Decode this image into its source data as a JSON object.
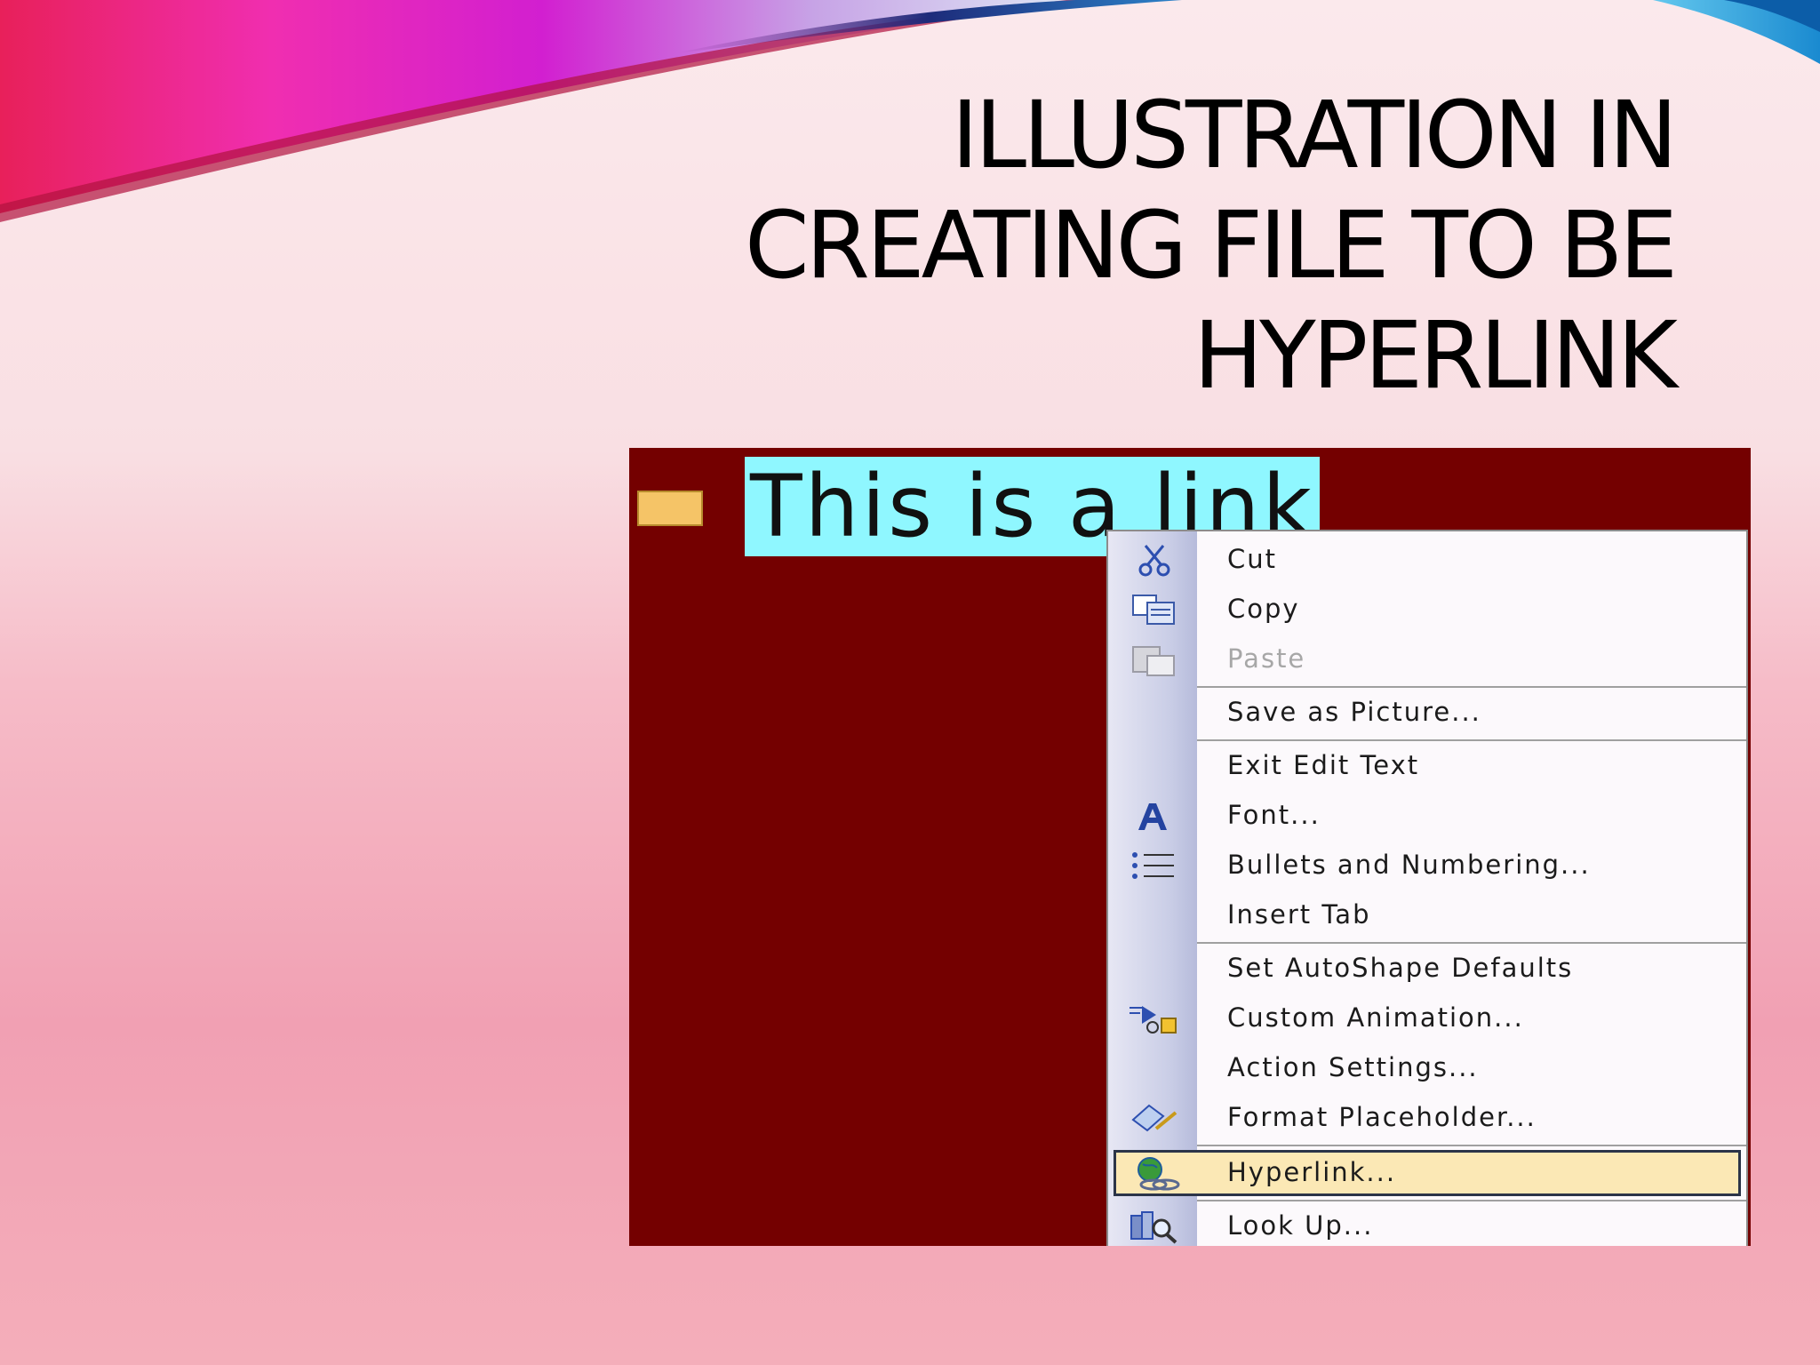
{
  "slide": {
    "title_lines": [
      "ILLUSTRATION IN",
      "CREATING FILE TO BE",
      "HYPERLINK"
    ]
  },
  "screenshot": {
    "selected_text": "This is a link",
    "colors": {
      "background": "#740000",
      "selection": "#8ff7ff",
      "menu_highlight": "#fbe8b5"
    }
  },
  "context_menu": {
    "items": [
      {
        "label": "Cut",
        "icon": "scissors-icon",
        "disabled": false
      },
      {
        "label": "Copy",
        "icon": "copy-icon",
        "disabled": false
      },
      {
        "label": "Paste",
        "icon": "paste-icon",
        "disabled": true
      },
      {
        "label": "Save as Picture...",
        "icon": "",
        "disabled": false
      },
      {
        "label": "Exit Edit Text",
        "icon": "",
        "disabled": false
      },
      {
        "label": "Font...",
        "icon": "font-icon",
        "disabled": false
      },
      {
        "label": "Bullets and Numbering...",
        "icon": "bullets-icon",
        "disabled": false
      },
      {
        "label": "Insert Tab",
        "icon": "",
        "disabled": false
      },
      {
        "label": "Set AutoShape Defaults",
        "icon": "",
        "disabled": false
      },
      {
        "label": "Custom Animation...",
        "icon": "animation-icon",
        "disabled": false
      },
      {
        "label": "Action Settings...",
        "icon": "",
        "disabled": false
      },
      {
        "label": "Format Placeholder...",
        "icon": "format-placeholder-icon",
        "disabled": false
      },
      {
        "label": "Hyperlink...",
        "icon": "hyperlink-icon",
        "highlighted": true
      },
      {
        "label": "Look Up...",
        "icon": "look-up-icon",
        "disabled": false
      }
    ]
  }
}
